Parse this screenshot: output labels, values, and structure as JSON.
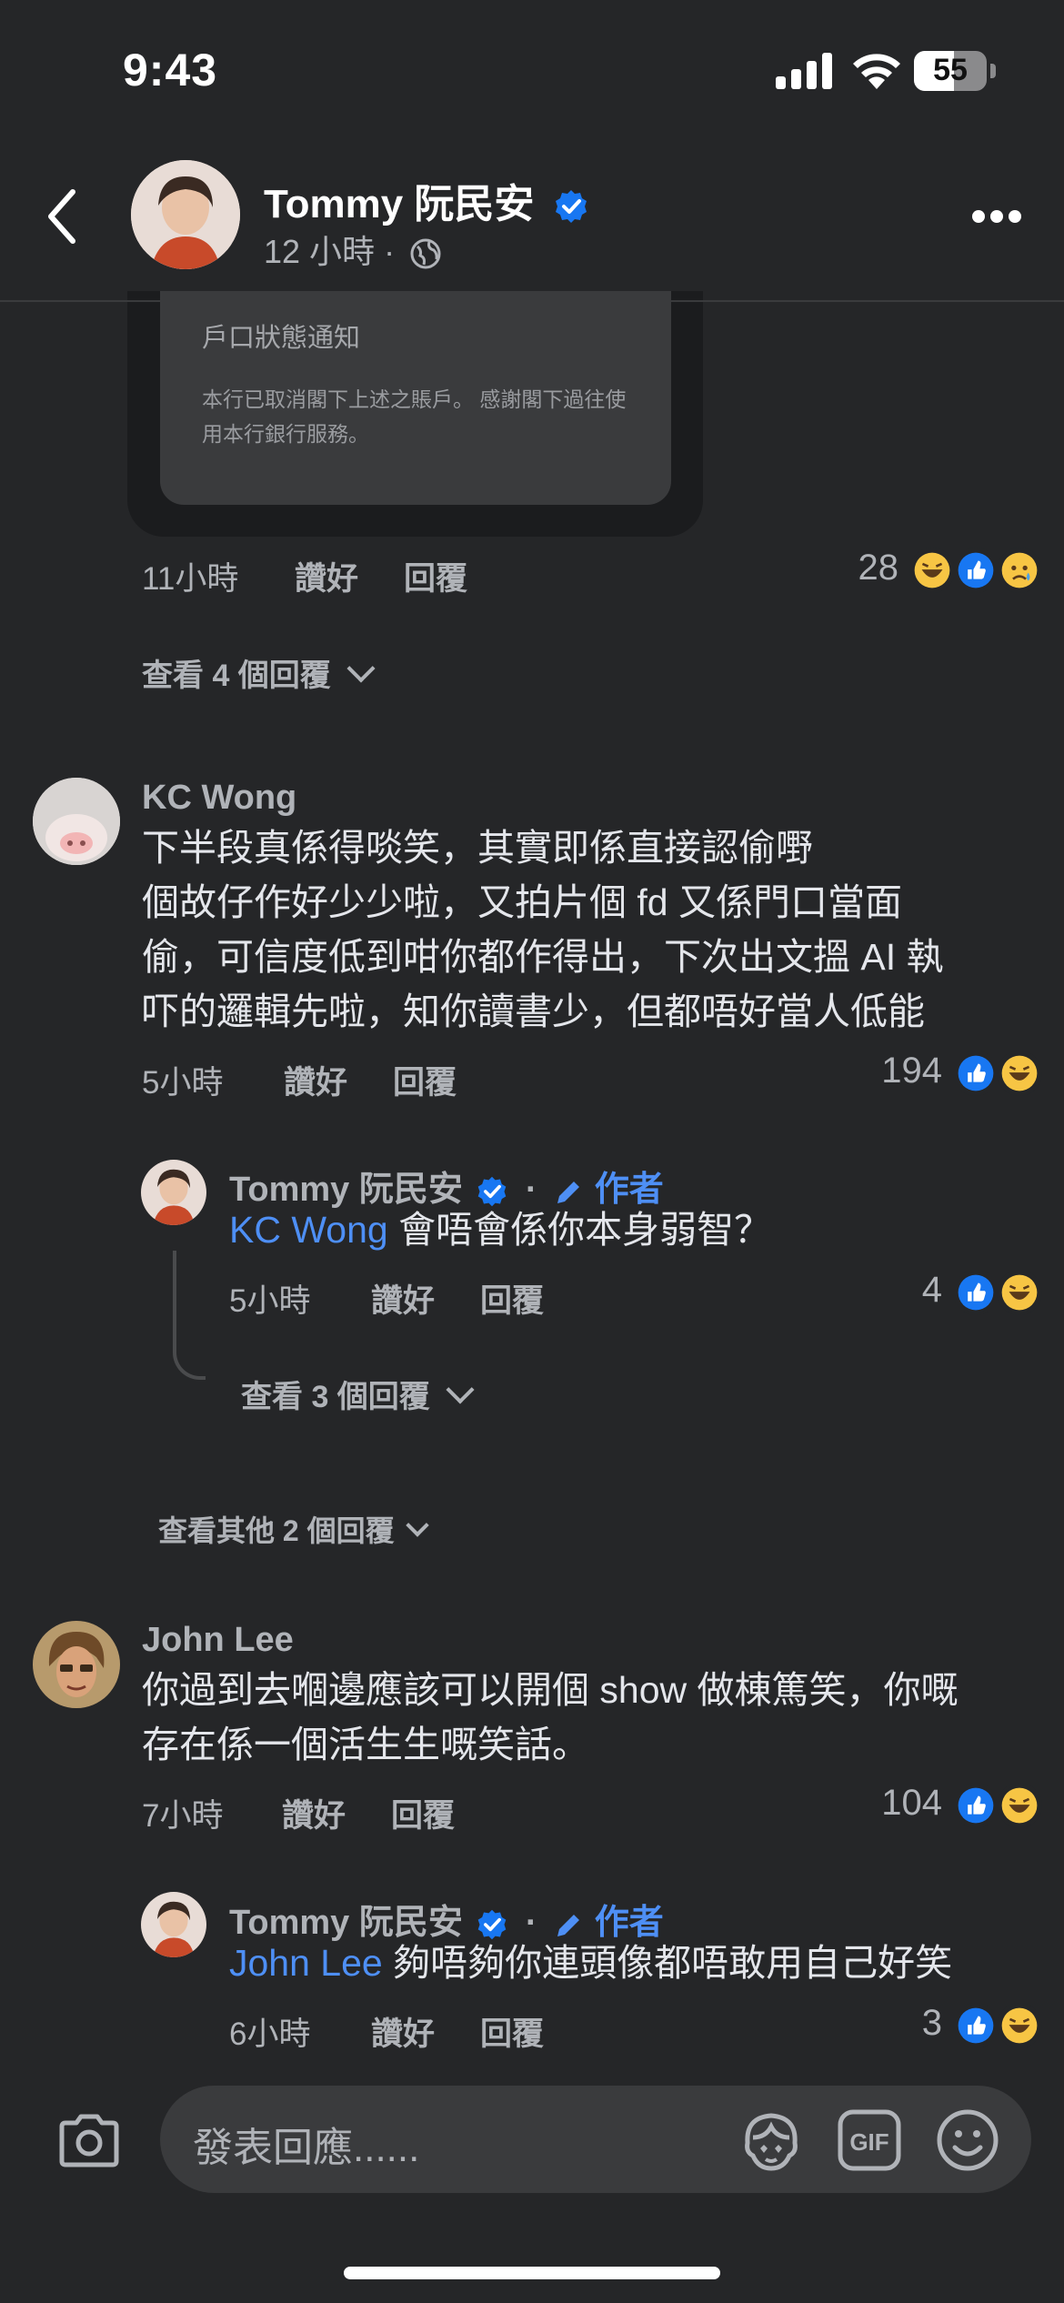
{
  "status_bar": {
    "time": "9:43",
    "battery": "55",
    "battery_level": 0.55
  },
  "header": {
    "name": "Tommy 阮民安",
    "time": "12 小時",
    "dot": "·"
  },
  "attachment": {
    "title": "戶口狀態通知",
    "body": "本行已取消閣下上述之賬戶。 感謝閣下過往使用本行銀行服務。"
  },
  "comment0": {
    "time": "11小時",
    "like": "讚好",
    "reply": "回覆",
    "count": "28",
    "view_replies": "查看 4 個回覆"
  },
  "comment1": {
    "name": "KC Wong",
    "lines": [
      "下半段真係得啖笑，其實即係直接認偷嘢",
      "個故仔作好少少啦，又拍片個 fd 又係門口當面",
      "偷，可信度低到咁你都作得出，下次出文搵 AI 執",
      "吓的邏輯先啦，知你讀書少，但都唔好當人低能"
    ],
    "time": "5小時",
    "like": "讚好",
    "reply": "回覆",
    "count": "194"
  },
  "reply1": {
    "name": "Tommy 阮民安",
    "dot": "·",
    "author": "作者",
    "mention": "KC Wong",
    "text": " 會唔會係你本身弱智？",
    "time": "5小時",
    "like": "讚好",
    "reply": "回覆",
    "count": "4",
    "view_replies": "查看 3 個回覆"
  },
  "view_other": "查看其他 2 個回覆",
  "comment2": {
    "name": "John Lee",
    "lines": [
      "你過到去嗰邊應該可以開個 show 做棟篤笑，你嘅",
      "存在係一個活生生嘅笑話。"
    ],
    "time": "7小時",
    "like": "讚好",
    "reply": "回覆",
    "count": "104"
  },
  "reply2": {
    "name": "Tommy 阮民安",
    "dot": "·",
    "author": "作者",
    "mention": "John Lee",
    "text": " 夠唔夠你連頭像都唔敢用自己好笑",
    "time": "6小時",
    "like": "讚好",
    "reply": "回覆",
    "count": "3"
  },
  "composer": {
    "placeholder": "發表回應......"
  },
  "colors": {
    "accent": "#4e8ff5",
    "background": "#252628",
    "like_blue": "#1877f2",
    "emoji_yellow": "#f7c544"
  },
  "icons": [
    "back-arrow-icon",
    "verified-badge-icon",
    "globe-icon",
    "more-icon",
    "like-icon",
    "haha-icon",
    "sad-icon",
    "pencil-icon",
    "camera-icon",
    "avatar-sticker-icon",
    "gif-icon",
    "emoji-icon"
  ]
}
